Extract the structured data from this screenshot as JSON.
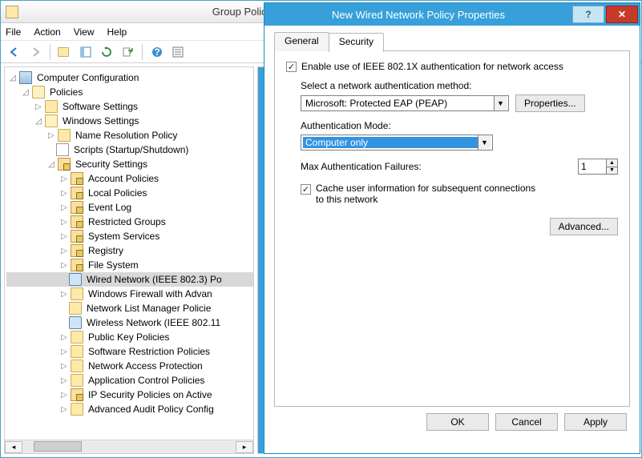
{
  "window": {
    "title": "Group Policy Management Editor"
  },
  "menu": {
    "file": "File",
    "action": "Action",
    "view": "View",
    "help": "Help"
  },
  "tree": {
    "root": "Computer Configuration",
    "policies": "Policies",
    "software_settings": "Software Settings",
    "windows_settings": "Windows Settings",
    "name_resolution": "Name Resolution Policy",
    "scripts": "Scripts (Startup/Shutdown)",
    "security_settings": "Security Settings",
    "account_policies": "Account Policies",
    "local_policies": "Local Policies",
    "event_log": "Event Log",
    "restricted_groups": "Restricted Groups",
    "system_services": "System Services",
    "registry": "Registry",
    "file_system": "File System",
    "wired_network": "Wired Network (IEEE 802.3) Po",
    "windows_firewall": "Windows Firewall with Advan",
    "network_list": "Network List Manager Policie",
    "wireless_network": "Wireless Network (IEEE 802.11",
    "public_key": "Public Key Policies",
    "software_restriction": "Software Restriction Policies",
    "network_access": "Network Access Protection",
    "app_control": "Application Control Policies",
    "ip_security": "IP Security Policies on Active",
    "advanced_audit": "Advanced Audit Policy Config"
  },
  "dialog": {
    "title": "New Wired Network Policy Properties",
    "tabs": {
      "general": "General",
      "security": "Security"
    },
    "enable_label": "Enable use of IEEE 802.1X authentication for network access",
    "auth_method_label": "Select a network authentication method:",
    "auth_method_value": "Microsoft: Protected EAP (PEAP)",
    "properties_btn": "Properties...",
    "auth_mode_label": "Authentication Mode:",
    "auth_mode_value": "Computer only",
    "max_fail_label": "Max Authentication Failures:",
    "max_fail_value": "1",
    "cache_label1": "Cache user information for subsequent connections",
    "cache_label2": "to this network",
    "advanced_btn": "Advanced...",
    "ok": "OK",
    "cancel": "Cancel",
    "apply": "Apply"
  }
}
